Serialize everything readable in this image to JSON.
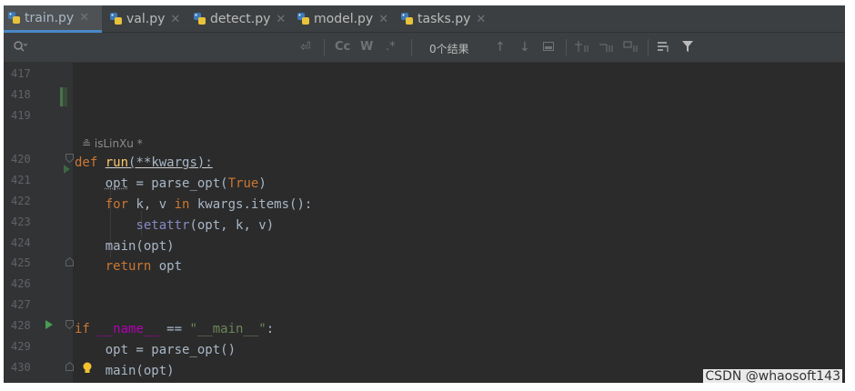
{
  "tabs": [
    {
      "label": "train.py",
      "active": true
    },
    {
      "label": "val.py",
      "active": false
    },
    {
      "label": "detect.py",
      "active": false
    },
    {
      "label": "model.py",
      "active": false
    },
    {
      "label": "tasks.py",
      "active": false
    }
  ],
  "search": {
    "result_count": "0个结果",
    "match_case": "Cc",
    "whole_word": "W",
    "regex": ".*"
  },
  "editor": {
    "author_hint": "isLinXu *",
    "line_numbers": [
      "417",
      "418",
      "419",
      "420",
      "421",
      "422",
      "423",
      "424",
      "425",
      "426",
      "427",
      "428",
      "429",
      "430"
    ]
  },
  "colors": {
    "background": "#2b2b2b",
    "keyword": "#cc7832",
    "function": "#ffc66d",
    "string": "#6a8759",
    "builtin": "#8888c6",
    "dunder": "#b200b2"
  },
  "watermark": "CSDN @whaosoft143"
}
